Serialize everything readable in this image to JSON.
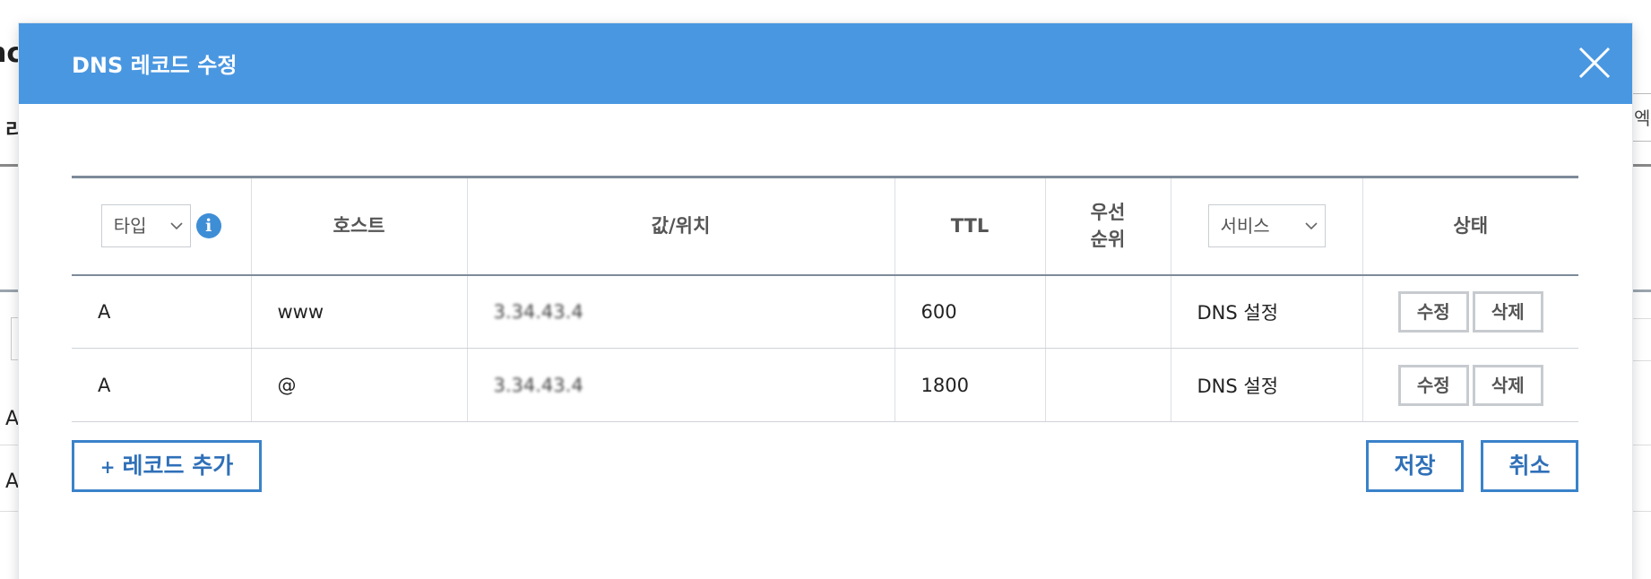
{
  "modal": {
    "title": "DNS 레코드 수정"
  },
  "table": {
    "headers": {
      "type_select": "타입",
      "host": "호스트",
      "value": "값/위치",
      "ttl": "TTL",
      "priority_line1": "우선",
      "priority_line2": "순위",
      "service_select": "서비스",
      "status": "상태"
    },
    "rows": [
      {
        "type": "A",
        "host": "www",
        "value": "3.34.43.4",
        "ttl": "600",
        "priority": "",
        "service": "DNS 설정",
        "edit": "수정",
        "delete": "삭제"
      },
      {
        "type": "A",
        "host": "@",
        "value": "3.34.43.4",
        "ttl": "1800",
        "priority": "",
        "service": "DNS 설정",
        "edit": "수정",
        "delete": "삭제"
      }
    ]
  },
  "footer": {
    "add_record": "레코드 추가",
    "add_icon": "+",
    "save": "저장",
    "cancel": "취소"
  },
  "background": {
    "left_char": "nc",
    "left_tab": "리",
    "right_btn": "엑셀",
    "row_a1": "A",
    "row_a2": "A"
  },
  "colors": {
    "header_bg": "#4a97e1",
    "button_border": "#3a82c9",
    "info_icon": "#3e8ed6"
  },
  "icons": {
    "close": "close-icon",
    "info": "info-icon",
    "chevron": "chevron-down-icon"
  }
}
